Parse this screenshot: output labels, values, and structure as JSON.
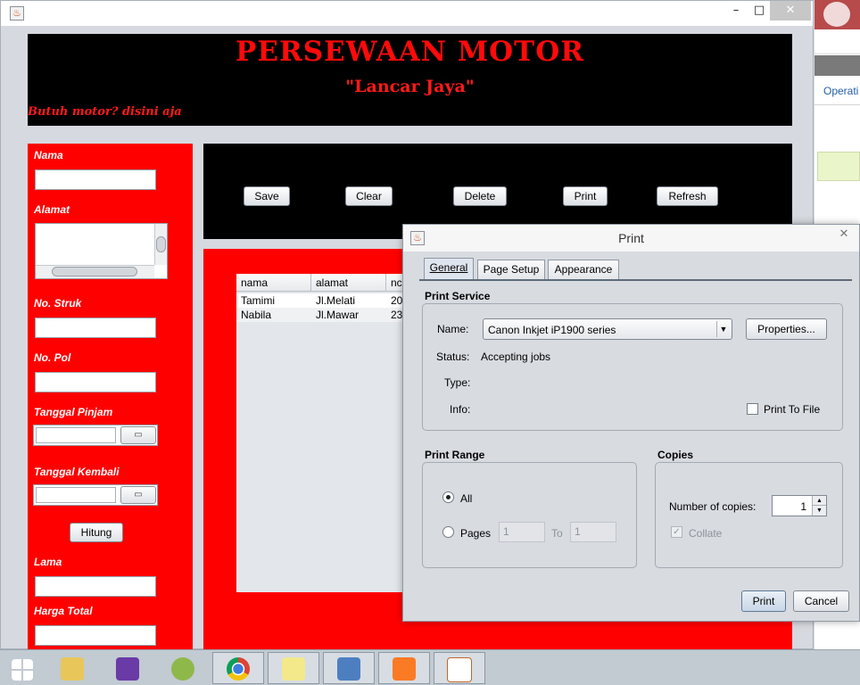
{
  "header": {
    "title": "PERSEWAAN MOTOR",
    "subtitle": "\"Lancar Jaya\"",
    "tagline": "Butuh motor? disini aja"
  },
  "form": {
    "nama_label": "Nama",
    "alamat_label": "Alamat",
    "no_struk_label": "No. Struk",
    "no_pol_label": "No. Pol",
    "tanggal_pinjam_label": "Tanggal Pinjam",
    "tanggal_kembali_label": "Tanggal Kembali",
    "hitung_label": "Hitung",
    "lama_label": "Lama",
    "harga_total_label": "Harga Total"
  },
  "toolbar": {
    "save": "Save",
    "clear": "Clear",
    "delete": "Delete",
    "print": "Print",
    "refresh": "Refresh"
  },
  "table": {
    "columns": [
      "nama",
      "alamat",
      "nc"
    ],
    "rows": [
      [
        "Tamimi",
        "Jl.Melati",
        "20"
      ],
      [
        "Nabila",
        "Jl.Mawar",
        "23"
      ]
    ]
  },
  "background_app": {
    "partial_text": "Operati"
  },
  "print_dialog": {
    "title": "Print",
    "tabs": [
      "General",
      "Page Setup",
      "Appearance"
    ],
    "print_service": {
      "heading": "Print Service",
      "name_label": "Name:",
      "name_value": "Canon Inkjet iP1900 series",
      "properties_button": "Properties...",
      "status_label": "Status:",
      "status_value": "Accepting jobs",
      "type_label": "Type:",
      "info_label": "Info:",
      "print_to_file_label": "Print To File",
      "print_to_file_checked": false
    },
    "print_range": {
      "heading": "Print Range",
      "all_label": "All",
      "all_selected": true,
      "pages_label": "Pages",
      "pages_from": "1",
      "to_label": "To",
      "pages_to": "1"
    },
    "copies": {
      "heading": "Copies",
      "number_label": "Number of copies:",
      "number_value": "1",
      "collate_label": "Collate",
      "collate_checked": true
    },
    "print_button": "Print",
    "cancel_button": "Cancel"
  },
  "taskbar": {
    "icons": [
      "windows-start-icon",
      "file-explorer-icon",
      "visual-studio-icon",
      "android-studio-icon",
      "chrome-icon",
      "sticky-notes-icon",
      "virtualbox-icon",
      "xampp-icon",
      "java-icon"
    ]
  },
  "colors": {
    "accent_red": "#ff0000",
    "header_black": "#000000",
    "dialog_bg": "#d8dbe0"
  }
}
